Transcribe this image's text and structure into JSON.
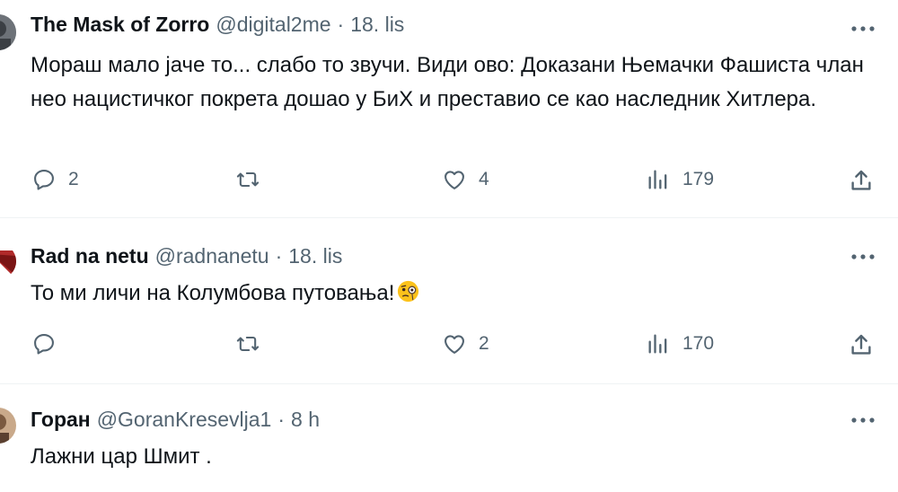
{
  "tweets": [
    {
      "name": "The Mask of Zorro",
      "handle": "@digital2me",
      "separator": "·",
      "time": "18. lis",
      "text": "Мораш мало јаче то... слабо то звучи. Види ово: Доказани Њемачки Фашиста члан нео нацистичког покрета дошао у БиХ и преставио се као наследник Хитлера.",
      "reply_count": "2",
      "retweet_count": "",
      "like_count": "4",
      "view_count": "179"
    },
    {
      "name": "Rad na netu",
      "handle": "@radnanetu",
      "separator": "·",
      "time": "18. lis",
      "text": "То ми личи на Колумбова путовања!",
      "emoji_icon": "face-with-monocle-icon",
      "reply_count": "",
      "retweet_count": "",
      "like_count": "2",
      "view_count": "170"
    },
    {
      "name": "Горан",
      "handle": "@GoranKresevlja1",
      "separator": "·",
      "time": "8 h",
      "text": "Лажни цар Шмит ."
    }
  ],
  "icons": {
    "more": "more-horizontal-icon",
    "reply": "reply-bubble-icon",
    "retweet": "retweet-icon",
    "like": "heart-icon",
    "views": "bar-chart-icon",
    "share": "share-upload-icon"
  },
  "colors": {
    "primary_text": "#0f1419",
    "secondary_text": "#536471",
    "divider": "#eff3f4"
  }
}
